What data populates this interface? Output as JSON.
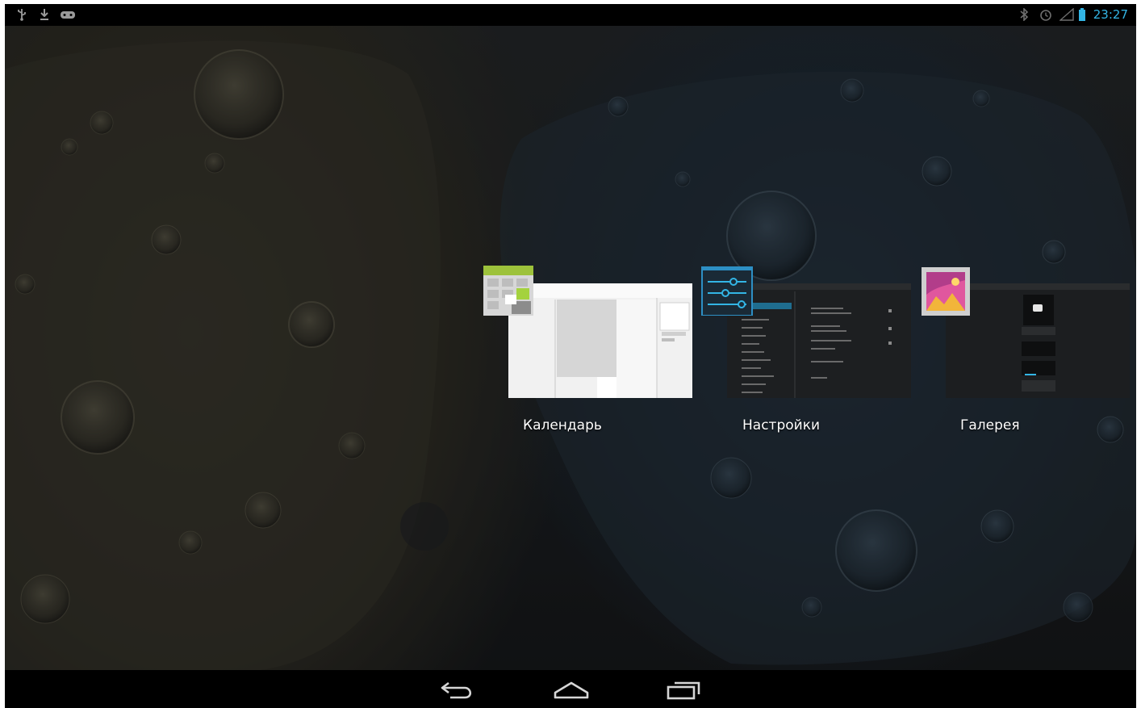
{
  "status_bar": {
    "left_icons": [
      "usb-icon",
      "download-icon",
      "gamepad-icon"
    ],
    "right_icons": [
      "bluetooth-icon",
      "alarm-icon",
      "signal-icon",
      "battery-icon"
    ],
    "time": "23:27",
    "accent_color": "#33b5e5"
  },
  "recents": [
    {
      "label": "Календарь",
      "icon": "calendar-icon"
    },
    {
      "label": "Настройки",
      "icon": "settings-icon"
    },
    {
      "label": "Галерея",
      "icon": "gallery-icon"
    }
  ],
  "nav_bar": {
    "buttons": [
      "back-icon",
      "home-icon",
      "recent-apps-icon"
    ]
  }
}
